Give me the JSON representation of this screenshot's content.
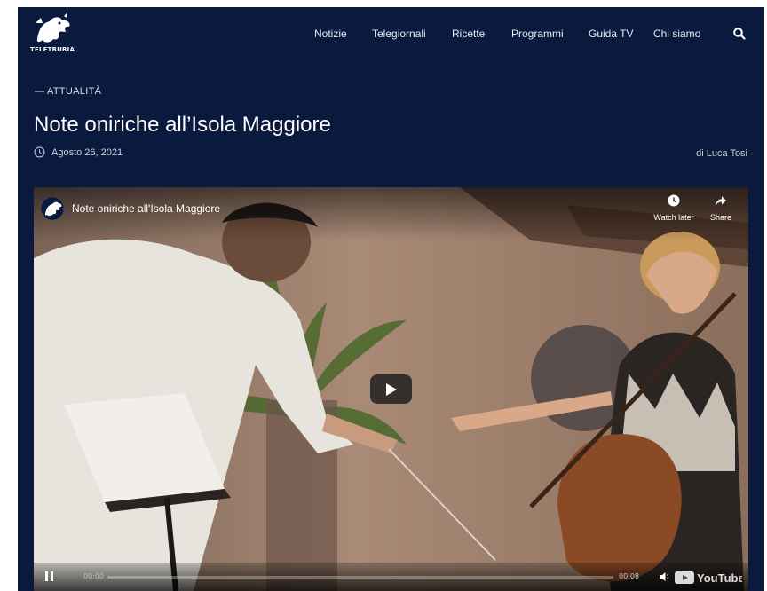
{
  "site": {
    "logo_text": "TELETRURIA"
  },
  "nav": {
    "items": [
      {
        "label": "Notizie"
      },
      {
        "label": "Telegiornali"
      },
      {
        "label": "Ricette"
      },
      {
        "label": "Programmi"
      },
      {
        "label": "Guida TV"
      },
      {
        "label": "Chi siamo"
      }
    ]
  },
  "article": {
    "category": "— ATTUALITÀ",
    "title": "Note oniriche all’Isola Maggiore",
    "date": "Agosto 26, 2021",
    "author": "di Luca Tosi"
  },
  "video": {
    "title": "Note oniriche all'Isola Maggiore",
    "watch_later_label": "Watch later",
    "share_label": "Share",
    "current_time": "00:00",
    "duration": "00:08",
    "progress": 0,
    "youtube_label": "YouTube"
  },
  "colors": {
    "background": "#0a1a3e",
    "text": "#ffffff",
    "muted": "#c9cfdd"
  },
  "icons": [
    "search-icon",
    "clock-icon",
    "play-icon",
    "pause-icon",
    "clock-watch-later-icon",
    "share-arrow-icon",
    "volume-icon"
  ]
}
